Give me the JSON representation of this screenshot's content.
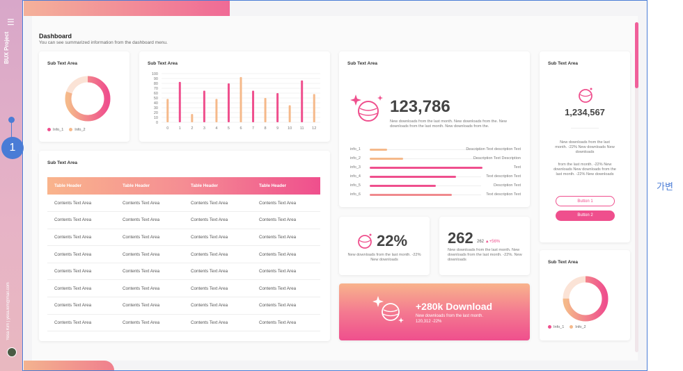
{
  "sidebar": {
    "menu_icon": "hamburger-icon",
    "project_name": "BUX Project",
    "marker": "1",
    "footer": "Yesa Kim | yesa.kim@mail.com",
    "avatar_icon": "planet-avatar-icon"
  },
  "header": {
    "title": "Dashboard",
    "subtitle": "You can see summarized information from the dashboard menu."
  },
  "donut1": {
    "label": "Sub Text Area",
    "legend": [
      "Info_1",
      "Info_2"
    ],
    "colors": [
      "#ef4f8d",
      "#f5b98a"
    ],
    "value_fraction": 0.8
  },
  "bar_chart_card": {
    "label": "Sub Text Area"
  },
  "chart_data": {
    "type": "bar",
    "categories": [
      "0",
      "1",
      "2",
      "3",
      "4",
      "5",
      "6",
      "7",
      "8",
      "9",
      "10",
      "11",
      "12"
    ],
    "values": [
      48,
      83,
      17,
      65,
      48,
      80,
      93,
      65,
      50,
      60,
      35,
      86,
      58
    ],
    "ylim": [
      0,
      100
    ],
    "yticks": [
      "100",
      "90",
      "80",
      "70",
      "60",
      "50",
      "40",
      "30",
      "20",
      "10",
      "0"
    ],
    "grid": true,
    "colors": [
      "#f5b98a",
      "#ef4f8d"
    ]
  },
  "stats_card": {
    "label": "Sub Text Area",
    "value": "123,786",
    "desc": "New downloads from the last month. New downloads from the. New downloads from the last month. New downloads from the.",
    "icon": "planet-sparkle-icon",
    "rows": [
      {
        "name": "info_1",
        "desc": "Description Text description Text",
        "fill": 0.13
      },
      {
        "name": "info_2",
        "desc": "Description Text Description",
        "fill": 0.25
      },
      {
        "name": "info_3",
        "desc": "Text",
        "fill": 0.85
      },
      {
        "name": "info_4",
        "desc": "Text description Text",
        "fill": 0.65
      },
      {
        "name": "info_5",
        "desc": "Description Text",
        "fill": 0.5
      },
      {
        "name": "info_6",
        "desc": "Text description Text",
        "fill": 0.62
      }
    ]
  },
  "right_card": {
    "label": "Sub Text Area",
    "icon": "planet-icon",
    "value": "1,234,567",
    "desc1": "New downloads from the last month. -22% New downloads New downloads",
    "desc2": "from the last month. -22% New downloads New downloads from the last month. -22% New downloads",
    "button1": "Button 1",
    "button2": "Button 2"
  },
  "table_card": {
    "label": "Sub Text Area",
    "headers": [
      "Table Header",
      "Table Header",
      "Table Header",
      "Table Header"
    ],
    "rows": [
      [
        "Contents Text Area",
        "Contents Text Area",
        "Contents Text Area",
        "Contents Text Area"
      ],
      [
        "Contents Text Area",
        "Contents Text Area",
        "Contents Text Area",
        "Contents Text Area"
      ],
      [
        "Contents Text Area",
        "Contents Text Area",
        "Contents Text Area",
        "Contents Text Area"
      ],
      [
        "Contents Text Area",
        "Contents Text Area",
        "Contents Text Area",
        "Contents Text Area"
      ],
      [
        "Contents Text Area",
        "Contents Text Area",
        "Contents Text Area",
        "Contents Text Area"
      ],
      [
        "Contents Text Area",
        "Contents Text Area",
        "Contents Text Area",
        "Contents Text Area"
      ],
      [
        "Contents Text Area",
        "Contents Text Area",
        "Contents Text Area",
        "Contents Text Area"
      ],
      [
        "Contents Text Area",
        "Contents Text Area",
        "Contents Text Area",
        "Contents Text Area"
      ]
    ]
  },
  "pct_card": {
    "icon": "planet-icon",
    "value": "22%",
    "desc": "New downloads from the last month. -22% New downloads"
  },
  "num_card": {
    "value": "262",
    "sub": "262",
    "change": "▲+56%",
    "desc": "New downloads from the last month. New downloads from the last month. -22%. New downloads"
  },
  "download_card": {
    "icon": "planet-sparkle-icon",
    "title": "+280k Download",
    "desc": "New downloads from the last month.",
    "stat": "120,312  -22%"
  },
  "donut2": {
    "label": "Sub Text Area",
    "legend": [
      "Info_1",
      "Info_2"
    ],
    "colors": [
      "#ef4f8d",
      "#f5b98a"
    ],
    "value_fraction": 0.75
  },
  "annotation": {
    "text": "가변"
  }
}
